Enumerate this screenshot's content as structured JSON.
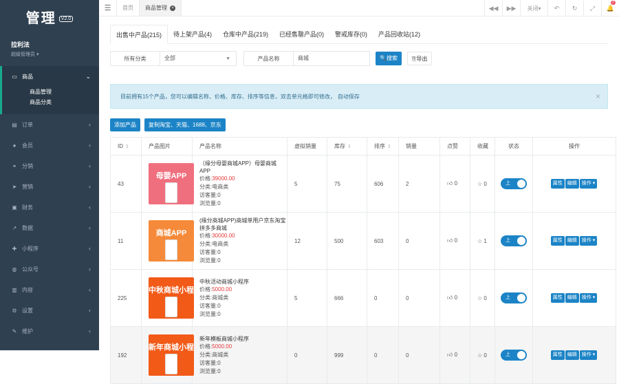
{
  "sidebar": {
    "logo": "管理",
    "version": "V2.0",
    "user_name": "拉利法",
    "user_role": "超级管理员",
    "active_menu": {
      "label": "商品",
      "icon": "laptop-icon",
      "subitems": [
        "商品管理",
        "商品分类"
      ]
    },
    "items": [
      {
        "label": "订单",
        "icon": "file-icon"
      },
      {
        "label": "会员",
        "icon": "user-icon"
      },
      {
        "label": "分销",
        "icon": "share-icon"
      },
      {
        "label": "营销",
        "icon": "send-icon"
      },
      {
        "label": "财务",
        "icon": "money-icon"
      },
      {
        "label": "数据",
        "icon": "chart-icon"
      },
      {
        "label": "小程序",
        "icon": "puzzle-icon"
      },
      {
        "label": "公众号",
        "icon": "wechat-icon"
      },
      {
        "label": "内容",
        "icon": "inbox-icon"
      },
      {
        "label": "设置",
        "icon": "gear-icon"
      },
      {
        "label": "维护",
        "icon": "wrench-icon"
      }
    ]
  },
  "topbar": {
    "tabs": [
      {
        "label": "首页"
      },
      {
        "label": "商品管理"
      }
    ],
    "close_label": "关闭",
    "notification_count": "7"
  },
  "status_tabs": [
    "出售中产品(215)",
    "待上架产品(4)",
    "仓库中产品(219)",
    "已经售罄产品(0)",
    "警戒库存(0)",
    "产品回收站(12)"
  ],
  "filters": {
    "category_label": "所有分类",
    "category_value": "全部",
    "name_label": "产品名称",
    "name_value": "商城",
    "search_label": "搜索",
    "export_label": "导出"
  },
  "alert": {
    "text": "目前拥有15个产品，您可以编辑名称、价格、库存、排序等信息，双击单元格即可修改，",
    "link": "自动保存"
  },
  "actions": {
    "add": "添加产品",
    "copy": "复制淘宝、天猫、1688、京东"
  },
  "table": {
    "headers": [
      "ID",
      "产品图片",
      "产品名称",
      "虚拟销量",
      "库存",
      "排序",
      "销量",
      "点赞",
      "收藏",
      "状态",
      "操作"
    ],
    "rows": [
      {
        "id": "43",
        "img_text": "母婴APP",
        "img_color": "#f06f7e",
        "name": "（缘分母婴商城APP）母婴商城APP",
        "price_label": "价格:",
        "price": "39000.00",
        "category": "分类:电商类",
        "visitors": "访客量:0",
        "views": "浏览量:0",
        "virtual_sales": "5",
        "stock": "75",
        "sort": "606",
        "sales": "2",
        "likes": "0",
        "favs": "0",
        "status": "上"
      },
      {
        "id": "11",
        "img_text": "商城APP",
        "img_color": "#f58a3a",
        "name": "(缘分商城APP)商城单用户京东淘宝拼多多商城",
        "price_label": "价格:",
        "price": "30000.00",
        "category": "分类:电商类",
        "visitors": "访客量:0",
        "views": "浏览量:0",
        "virtual_sales": "12",
        "stock": "500",
        "sort": "603",
        "sales": "0",
        "likes": "0",
        "favs": "1",
        "status": "上"
      },
      {
        "id": "225",
        "img_text": "中秋商城小程序",
        "img_color": "#f25a18",
        "name": "中秋活动商城小程序",
        "price_label": "价格:",
        "price": "5000.00",
        "category": "分类:商城类",
        "visitors": "访客量:0",
        "views": "浏览量:0",
        "virtual_sales": "5",
        "stock": "666",
        "sort": "0",
        "sales": "0",
        "likes": "0",
        "favs": "0",
        "status": "上"
      },
      {
        "id": "192",
        "img_text": "新年商城小程序",
        "img_color": "#f25a18",
        "name": "新年模板商城小程序",
        "price_label": "价格:",
        "price": "5000.00",
        "category": "分类:商城类",
        "visitors": "访客量:0",
        "views": "浏览量:0",
        "virtual_sales": "0",
        "stock": "999",
        "sort": "0",
        "sales": "0",
        "likes": "0",
        "favs": "0",
        "status": "上"
      }
    ],
    "op_labels": {
      "attr": "属性",
      "edit": "编辑",
      "more": "操作"
    }
  },
  "colors": {
    "sidebar_bg": "#2f4050",
    "primary": "#1c84c6",
    "price": "#e4393c"
  }
}
